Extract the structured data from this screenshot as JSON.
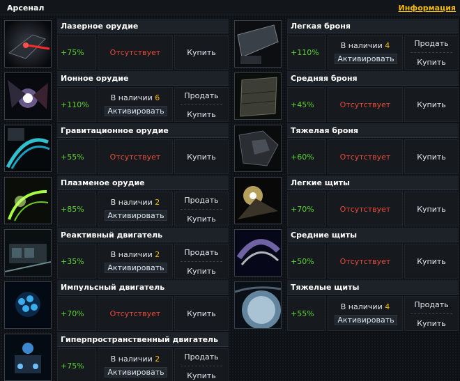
{
  "header": {
    "title": "Арсенал",
    "info_link": "Информация"
  },
  "labels": {
    "in_stock": "В наличии",
    "activate": "Активировать",
    "absent": "Отсутствует",
    "sell": "Продать",
    "buy": "Купить"
  },
  "left": [
    {
      "name": "Лазерное орудие",
      "pct": "+75%",
      "stock": null,
      "icon": "laser-cannon-icon"
    },
    {
      "name": "Ионное орудие",
      "pct": "+110%",
      "stock": "6",
      "icon": "ion-cannon-icon"
    },
    {
      "name": "Гравитационное орудие",
      "pct": "+55%",
      "stock": null,
      "icon": "gravity-cannon-icon"
    },
    {
      "name": "Плазменое орудие",
      "pct": "+85%",
      "stock": "2",
      "icon": "plasma-cannon-icon"
    },
    {
      "name": "Реактивный двигатель",
      "pct": "+35%",
      "stock": "2",
      "icon": "jet-engine-icon"
    },
    {
      "name": "Импульсный двигатель",
      "pct": "+70%",
      "stock": null,
      "icon": "impulse-engine-icon"
    },
    {
      "name": "Гиперпространственный двигатель",
      "pct": "+75%",
      "stock": "2",
      "icon": "hyperspace-engine-icon"
    }
  ],
  "right": [
    {
      "name": "Легкая броня",
      "pct": "+110%",
      "stock": "4",
      "icon": "light-armor-icon"
    },
    {
      "name": "Средняя броня",
      "pct": "+45%",
      "stock": null,
      "icon": "medium-armor-icon"
    },
    {
      "name": "Тяжелая броня",
      "pct": "+60%",
      "stock": null,
      "icon": "heavy-armor-icon"
    },
    {
      "name": "Легкие щиты",
      "pct": "+70%",
      "stock": null,
      "icon": "light-shields-icon"
    },
    {
      "name": "Средние щиты",
      "pct": "+50%",
      "stock": null,
      "icon": "medium-shields-icon"
    },
    {
      "name": "Тяжелые щиты",
      "pct": "+55%",
      "stock": "4",
      "icon": "heavy-shields-icon"
    }
  ],
  "colors": {
    "accent": "#f5b800",
    "positive": "#5ed233",
    "negative": "#e84a3a",
    "panel": "#161a1f",
    "name_bar": "#1d2228"
  }
}
